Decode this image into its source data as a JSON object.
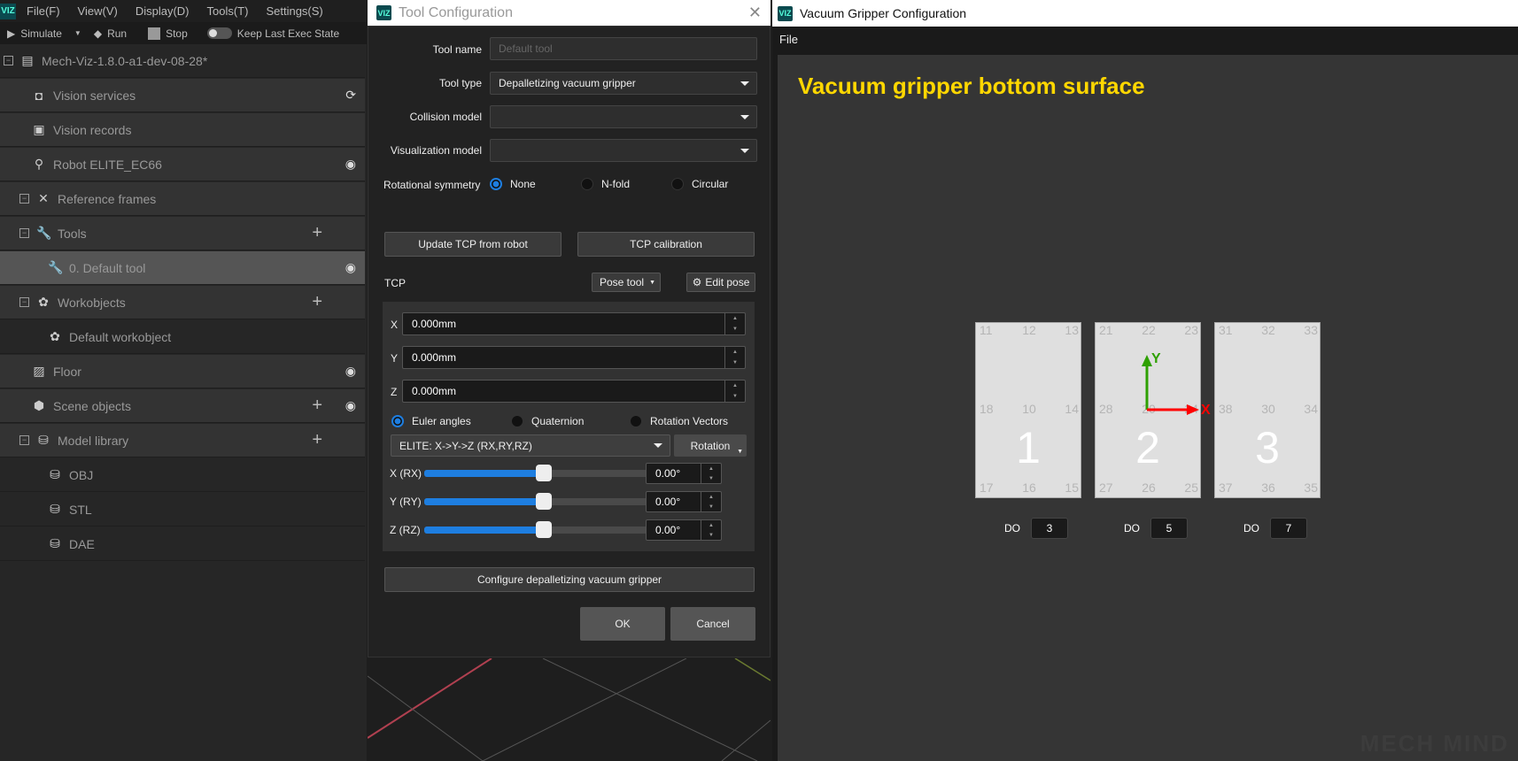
{
  "main": {
    "logo": "VIZ",
    "menu": [
      "File(F)",
      "View(V)",
      "Display(D)",
      "Tools(T)",
      "Settings(S)"
    ],
    "toolbar": {
      "simulate": "Simulate",
      "run": "Run",
      "stop": "Stop",
      "keep": "Keep Last Exec State"
    },
    "tree": [
      {
        "label": "Mech-Viz-1.8.0-a1-dev-08-28*",
        "icon": "folder-icon"
      },
      {
        "label": "Vision services",
        "icon": "camera-icon",
        "right2": "refresh-icon"
      },
      {
        "label": "Vision records",
        "icon": "records-icon"
      },
      {
        "label": "Robot ELITE_EC66",
        "icon": "robot-icon",
        "right2": "eye-icon"
      },
      {
        "label": "Reference frames",
        "icon": "frames-icon"
      },
      {
        "label": "Tools",
        "icon": "wrench-icon",
        "right1": "plus-icon"
      },
      {
        "label": "0. Default tool",
        "icon": "wrench-icon",
        "right2": "eye-icon"
      },
      {
        "label": "Workobjects",
        "icon": "workobject-icon",
        "right1": "plus-icon"
      },
      {
        "label": "Default workobject",
        "icon": "workobject-icon"
      },
      {
        "label": "Floor",
        "icon": "floor-icon",
        "right2": "eye-icon"
      },
      {
        "label": "Scene objects",
        "icon": "scene-icon",
        "right1": "plus-icon",
        "right2": "eye-icon"
      },
      {
        "label": "Model library",
        "icon": "database-icon",
        "right1": "plus-icon"
      },
      {
        "label": "OBJ",
        "icon": "database-icon"
      },
      {
        "label": "STL",
        "icon": "database-icon"
      },
      {
        "label": "DAE",
        "icon": "database-icon"
      }
    ]
  },
  "dialog": {
    "title": "Tool Configuration",
    "tool_name_label": "Tool name",
    "tool_name_placeholder": "Default tool",
    "tool_type_label": "Tool type",
    "tool_type": "Depalletizing vacuum gripper",
    "collision_label": "Collision model",
    "collision": "",
    "vis_label": "Visualization model",
    "vis": "",
    "rot_label": "Rotational symmetry",
    "rot_options": [
      "None",
      "N-fold",
      "Circular"
    ],
    "rot_selected": "None",
    "update_tcp": "Update TCP from robot",
    "tcp_calib": "TCP calibration",
    "tcp_label": "TCP",
    "pose_tool": "Pose tool",
    "edit_pose": "Edit pose",
    "x_label": "X",
    "x": "0.000mm",
    "y_label": "Y",
    "y": "0.000mm",
    "z_label": "Z",
    "z": "0.000mm",
    "rep_options": [
      "Euler angles",
      "Quaternion",
      "Rotation Vectors"
    ],
    "rep_selected": "Euler angles",
    "euler_order": "ELITE: X->Y->Z (RX,RY,RZ)",
    "rotation": "Rotation",
    "angles": [
      {
        "label": "X (RX)",
        "value": "0.00°",
        "slider": 0.5
      },
      {
        "label": "Y (RY)",
        "value": "0.00°",
        "slider": 0.5
      },
      {
        "label": "Z (RZ)",
        "value": "0.00°",
        "slider": 0.5
      }
    ],
    "configure": "Configure depalletizing vacuum gripper",
    "ok": "OK",
    "cancel": "Cancel"
  },
  "vacuum": {
    "title": "Vacuum Gripper Configuration",
    "menu": "File",
    "heading": "Vacuum gripper bottom surface",
    "heading_color": "#FFD700",
    "pads": [
      {
        "id": "1",
        "labels": [
          "11",
          "12",
          "13",
          "18",
          "10",
          "14",
          "17",
          "16",
          "15"
        ],
        "do": "3"
      },
      {
        "id": "2",
        "labels": [
          "21",
          "22",
          "23",
          "28",
          "20",
          "24",
          "27",
          "26",
          "25"
        ],
        "do": "5"
      },
      {
        "id": "3",
        "labels": [
          "31",
          "32",
          "33",
          "38",
          "30",
          "34",
          "37",
          "36",
          "35"
        ],
        "do": "7"
      }
    ],
    "do_label": "DO",
    "axis_x": "X",
    "axis_y": "Y",
    "axis_x_color": "#FF0000",
    "axis_y_color": "#2EA000",
    "watermark": "MECH MIND"
  }
}
